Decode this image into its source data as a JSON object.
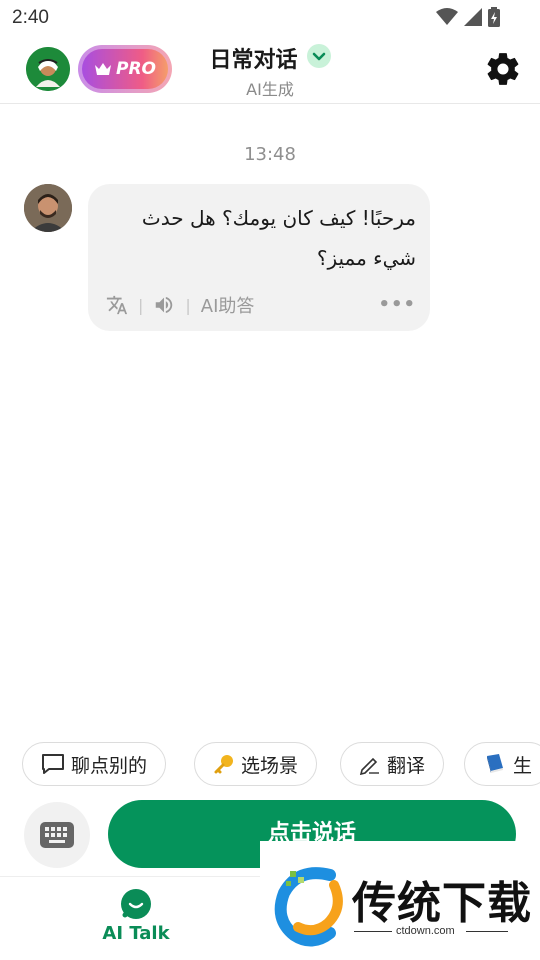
{
  "status_bar": {
    "time": "2:40",
    "icons": [
      "wifi-icon",
      "cell-signal-icon",
      "battery-charging-icon"
    ]
  },
  "header": {
    "title": "日常对话",
    "subtitle": "AI生成",
    "pro_label": "PRO",
    "icons": [
      "user-avatar",
      "crown-icon",
      "chevron-down-icon",
      "settings-gear-icon"
    ],
    "accent_color": "#c9f2d9"
  },
  "chat": {
    "timestamp": "13:48",
    "message": {
      "text": "مرحبًا! كيف كان يومك؟ هل حدث شيء مميز؟",
      "ai_help_label": "AI助答",
      "icons": [
        "translate-icon",
        "speaker-icon",
        "more-icon"
      ]
    }
  },
  "suggestions": [
    {
      "label": "聊点别的",
      "icon": "chat-bubble-icon"
    },
    {
      "label": "选场景",
      "icon": "key-icon"
    },
    {
      "label": "翻译",
      "icon": "pen-icon"
    },
    {
      "label": "生",
      "icon": "book-icon"
    }
  ],
  "input": {
    "talk_label": "点击说话",
    "keyboard_icon": "keyboard-icon",
    "primary_color": "#05935b"
  },
  "bottom_nav": {
    "items": [
      {
        "label": "AI Talk",
        "icon": "chat-icon",
        "active": true
      }
    ],
    "active_color": "#0a8c57"
  },
  "watermark": {
    "text": "传统下载",
    "domain": "ctdown.com"
  }
}
